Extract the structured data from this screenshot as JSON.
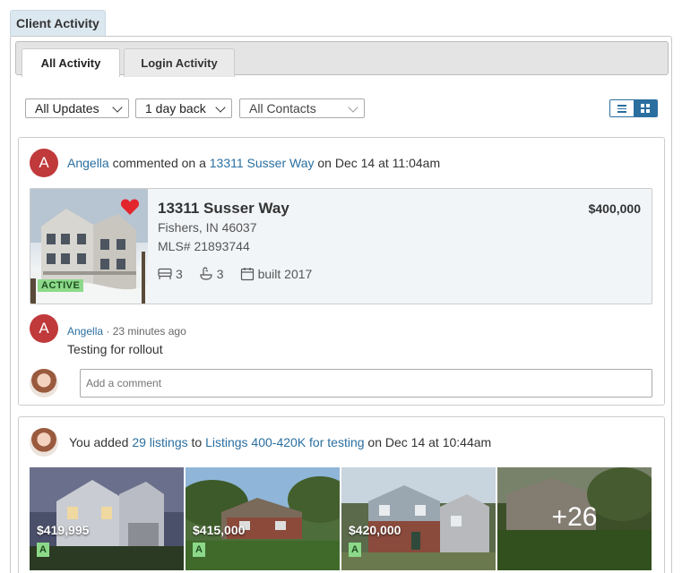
{
  "section_tab": "Client Activity",
  "tabs": {
    "all": "All Activity",
    "login": "Login Activity"
  },
  "filters": {
    "updates": "All Updates",
    "days": "1 day back",
    "contacts": "All Contacts"
  },
  "activity1": {
    "avatar_letter": "A",
    "user": "Angella",
    "verb": " commented on a ",
    "listing_link": "13311 Susser Way",
    "time": " on Dec 14 at 11:04am",
    "listing": {
      "title": "13311 Susser Way",
      "city": "Fishers, IN 46037",
      "mls": "MLS# 21893744",
      "price": "$400,000",
      "beds": "3",
      "baths": "3",
      "built": "built 2017",
      "status": "ACTIVE"
    },
    "comment": {
      "avatar_letter": "A",
      "user": "Angella",
      "ago": " · 23 minutes ago",
      "text": "Testing for rollout"
    },
    "input_placeholder": "Add a comment"
  },
  "activity2": {
    "prefix": "You added ",
    "count_link": "29 listings",
    "mid": " to ",
    "list_link": "Listings 400-420K for testing",
    "time": " on Dec 14 at 10:44am",
    "thumbs": [
      {
        "price": "$419,995",
        "badge": "A"
      },
      {
        "price": "$415,000",
        "badge": "A"
      },
      {
        "price": "$420,000",
        "badge": "A"
      }
    ],
    "more": "+26"
  },
  "colors": {
    "link": "#2a6fa0",
    "avatar": "#c0393b",
    "active_badge": "#8cd98a",
    "heart": "#e3262e"
  }
}
